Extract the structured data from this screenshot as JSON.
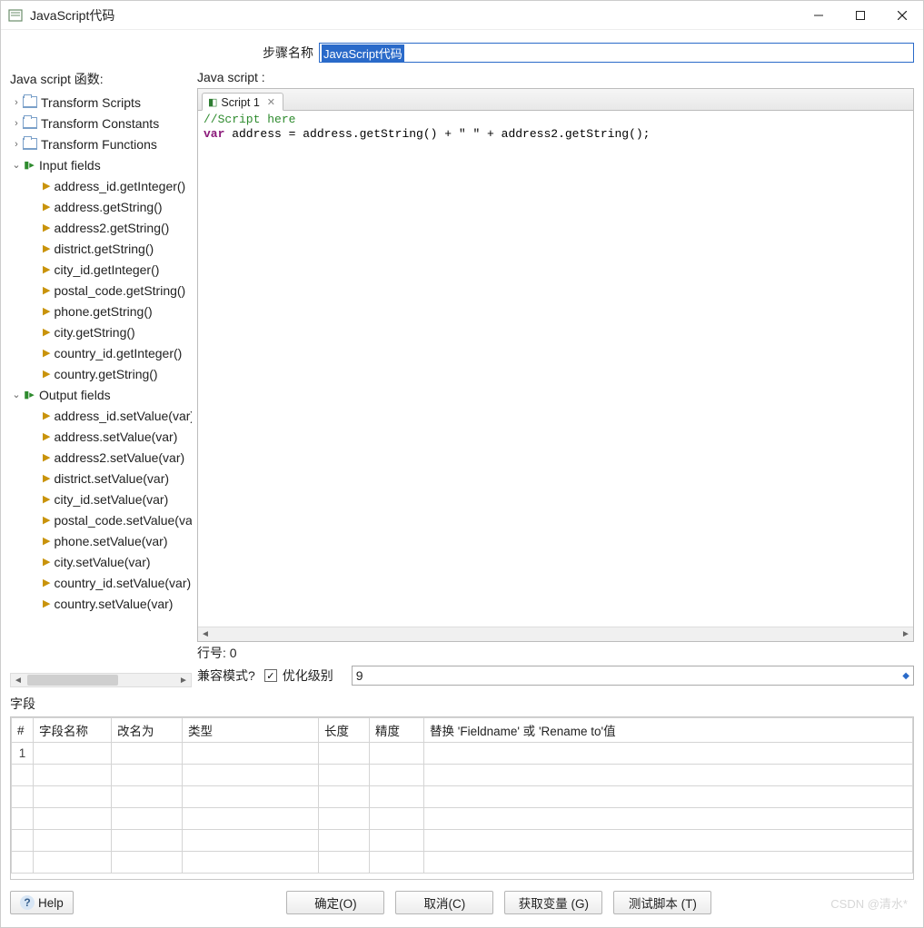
{
  "window": {
    "title": "JavaScript代码"
  },
  "step_name": {
    "label": "步骤名称",
    "value": "JavaScript代码"
  },
  "functions_header": "Java script 函数:",
  "script_header": "Java script :",
  "tree": {
    "folders": [
      {
        "label": "Transform Scripts"
      },
      {
        "label": "Transform Constants"
      },
      {
        "label": "Transform Functions"
      }
    ],
    "input_fields": {
      "label": "Input fields",
      "items": [
        "address_id.getInteger()",
        "address.getString()",
        "address2.getString()",
        "district.getString()",
        "city_id.getInteger()",
        "postal_code.getString()",
        "phone.getString()",
        "city.getString()",
        "country_id.getInteger()",
        "country.getString()"
      ]
    },
    "output_fields": {
      "label": "Output fields",
      "items": [
        "address_id.setValue(var)",
        "address.setValue(var)",
        "address2.setValue(var)",
        "district.setValue(var)",
        "city_id.setValue(var)",
        "postal_code.setValue(var)",
        "phone.setValue(var)",
        "city.setValue(var)",
        "country_id.setValue(var)",
        "country.setValue(var)"
      ]
    }
  },
  "tab": {
    "label": "Script 1"
  },
  "code": {
    "comment": "//Script here",
    "kw": "var",
    "rest": " address = address.getString() + \" \" + address2.getString();"
  },
  "line_no": {
    "label": "行号:",
    "value": "0"
  },
  "compat_label": "兼容模式?",
  "opt_level": {
    "label": "优化级别",
    "value": "9"
  },
  "fields_section": {
    "title": "字段",
    "columns": [
      "#",
      "字段名称",
      "改名为",
      "类型",
      "长度",
      "精度",
      "替换 'Fieldname' 或 'Rename to'值"
    ],
    "rows": [
      "1"
    ]
  },
  "buttons": {
    "help": "Help",
    "ok": "确定(O)",
    "cancel": "取消(C)",
    "get_vars": "获取变量 (G)",
    "test": "测试脚本 (T)"
  },
  "watermark": "CSDN @清水*"
}
